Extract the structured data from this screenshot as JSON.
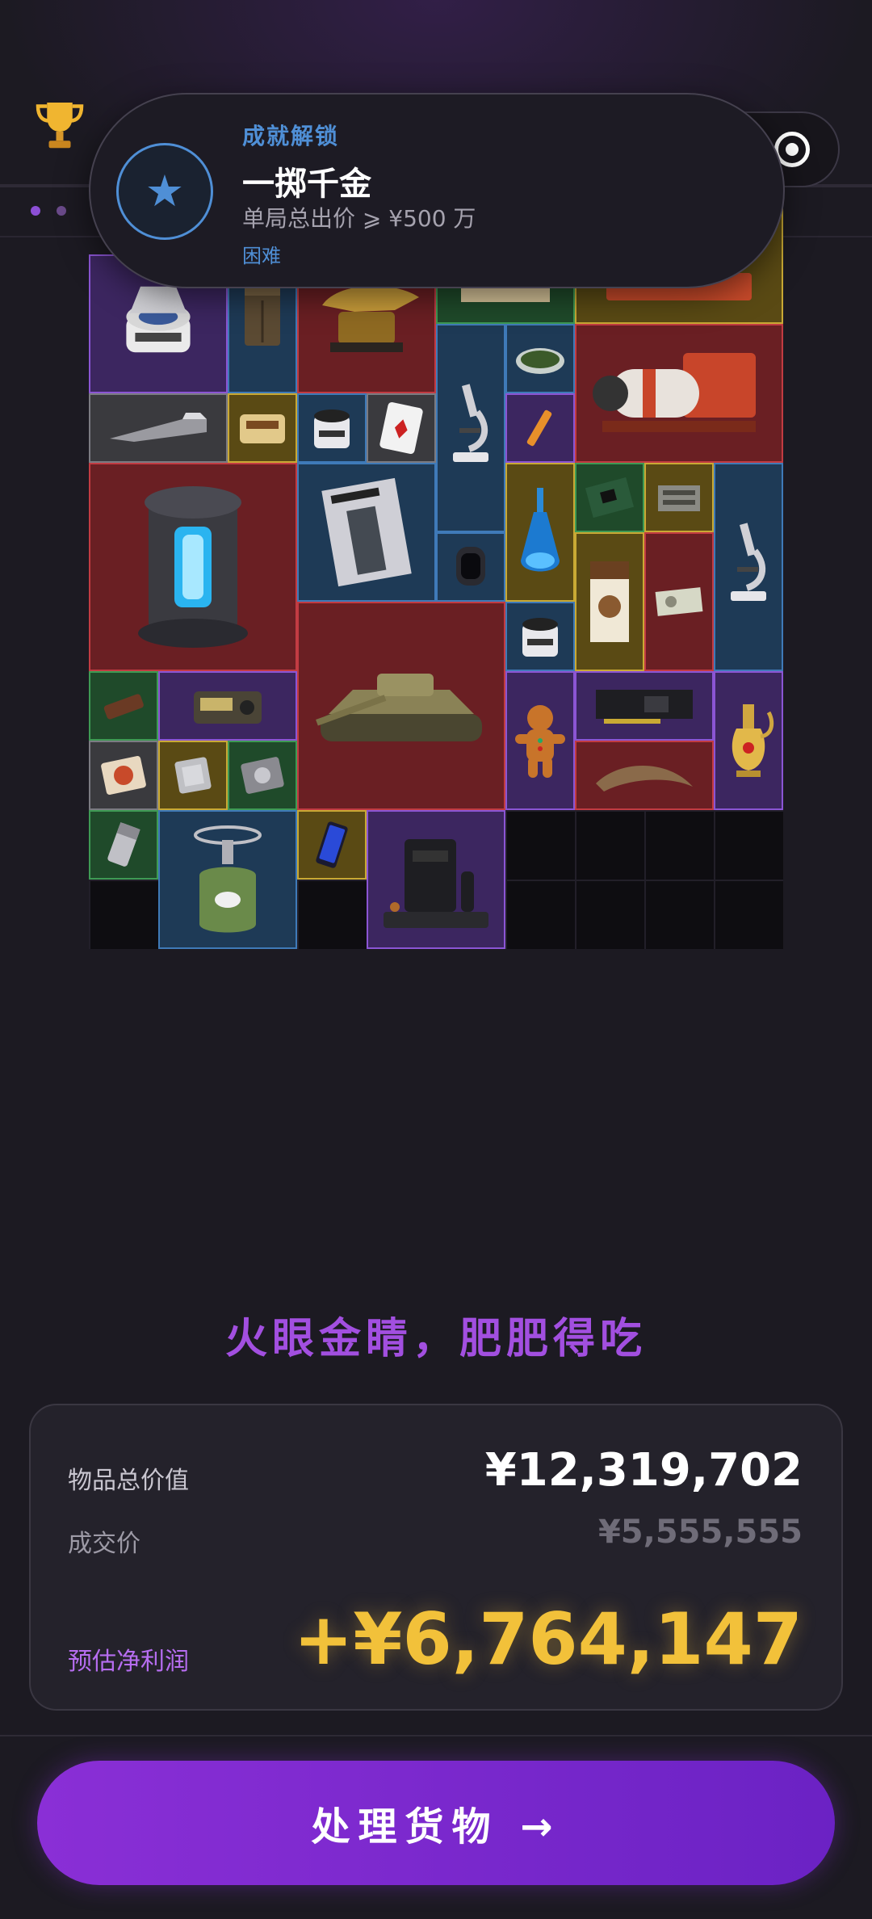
{
  "toast": {
    "kicker": "成就解锁",
    "title": "一掷千金",
    "description": "单局总出价 ⩾ ¥500 万",
    "difficulty": "困难"
  },
  "grid": {
    "items": [
      {
        "name": "centrifuge",
        "color": "purple"
      },
      {
        "name": "ammo-box",
        "color": "blue"
      },
      {
        "name": "golden-crocodile-statue",
        "color": "red"
      },
      {
        "name": "ancient-scroll",
        "color": "green"
      },
      {
        "name": "red-train-model",
        "color": "yellow"
      },
      {
        "name": "utility-knife",
        "color": "gray"
      },
      {
        "name": "cigarette-tin",
        "color": "yellow"
      },
      {
        "name": "sample-jar",
        "color": "blue"
      },
      {
        "name": "playing-card",
        "color": "gray"
      },
      {
        "name": "microscope",
        "color": "blue"
      },
      {
        "name": "petri-dish",
        "color": "blue"
      },
      {
        "name": "gas-cylinder-rig",
        "color": "red"
      },
      {
        "name": "syringe",
        "color": "purple"
      },
      {
        "name": "energy-reactor-core",
        "color": "red"
      },
      {
        "name": "fashion-magazine",
        "color": "blue"
      },
      {
        "name": "blue-potion-flask",
        "color": "yellow"
      },
      {
        "name": "circuit-board",
        "color": "green"
      },
      {
        "name": "electronic-module",
        "color": "yellow"
      },
      {
        "name": "microscope-2",
        "color": "blue"
      },
      {
        "name": "smartwatch",
        "color": "blue"
      },
      {
        "name": "sample-jar-2",
        "color": "blue"
      },
      {
        "name": "coffee-box",
        "color": "yellow"
      },
      {
        "name": "banknote",
        "color": "red"
      },
      {
        "name": "chocolate-bar",
        "color": "green"
      },
      {
        "name": "radio",
        "color": "purple"
      },
      {
        "name": "battle-tank",
        "color": "red"
      },
      {
        "name": "gingerbread-man",
        "color": "purple"
      },
      {
        "name": "graphics-card",
        "color": "purple"
      },
      {
        "name": "golden-teapot",
        "color": "purple"
      },
      {
        "name": "instant-noodles",
        "color": "gray"
      },
      {
        "name": "cpu-chip",
        "color": "yellow"
      },
      {
        "name": "hard-drive",
        "color": "green"
      },
      {
        "name": "dinosaur-claw",
        "color": "red"
      },
      {
        "name": "lighter",
        "color": "green"
      },
      {
        "name": "camping-stove",
        "color": "blue"
      },
      {
        "name": "smartphone",
        "color": "yellow"
      },
      {
        "name": "coffee-machine",
        "color": "purple"
      }
    ]
  },
  "slogan": "火眼金睛，肥肥得吃",
  "summary": {
    "total_label": "物品总价值",
    "total_value": "¥12,319,702",
    "deal_label": "成交价",
    "deal_value": "¥5,555,555",
    "profit_label": "预估净利润",
    "profit_value": "+¥6,764,147"
  },
  "cta": {
    "label": "处理货物 →"
  },
  "colors": {
    "accent": "#8a2fd6",
    "profit": "#f2c13a",
    "achievement": "#4f8fd6"
  }
}
